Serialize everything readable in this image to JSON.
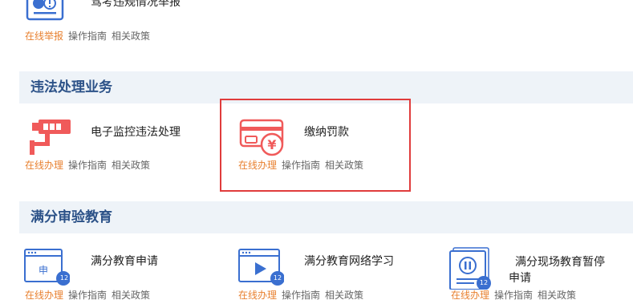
{
  "links": {
    "online_report": "在线举报",
    "online_handle": "在线办理",
    "guide": "操作指南",
    "policy": "相关政策"
  },
  "top_item": {
    "title": "驾考违规情况举报"
  },
  "section_violation": {
    "title": "违法处理业务",
    "items": [
      {
        "title": "电子监控违法处理",
        "icon": "surveillance-camera-icon"
      },
      {
        "title": "缴纳罚款",
        "icon": "payment-card-yuan-icon"
      }
    ]
  },
  "section_education": {
    "title": "满分审验教育",
    "items": [
      {
        "title": "满分教育申请",
        "icon": "application-window-icon",
        "badge": "12",
        "icon_text": "申"
      },
      {
        "title": "满分教育网络学习",
        "icon": "video-play-window-icon",
        "badge": "12"
      },
      {
        "title_line1": "满分现场教育暂停",
        "title_line2": "申请",
        "icon": "pause-document-icon",
        "badge": "12"
      }
    ]
  },
  "colors": {
    "section_bg": "#eef3f8",
    "section_title": "#2c5288",
    "online_link": "#e8802f",
    "icon_red": "#f05a5a",
    "icon_blue": "#3a6fd0",
    "highlight_border": "#e03c3c"
  }
}
